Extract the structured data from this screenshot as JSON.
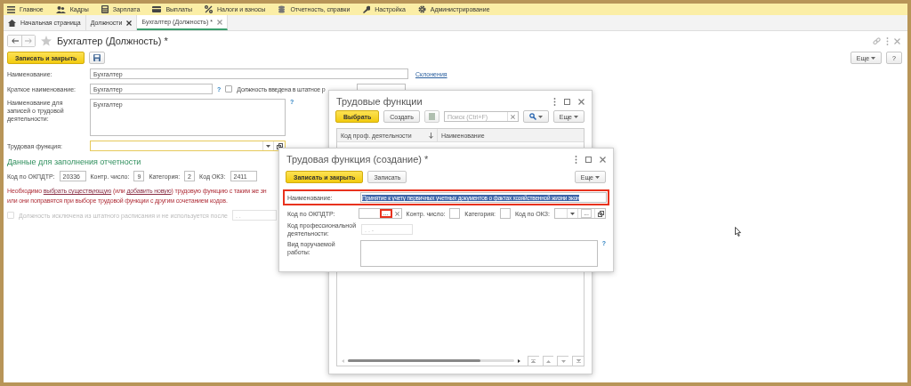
{
  "menu": [
    {
      "label": "Главное"
    },
    {
      "label": "Кадры"
    },
    {
      "label": "Зарплата"
    },
    {
      "label": "Выплаты"
    },
    {
      "label": "Налоги и взносы"
    },
    {
      "label": "Отчетность, справки"
    },
    {
      "label": "Настройка"
    },
    {
      "label": "Администрирование"
    }
  ],
  "tabs": [
    {
      "label": "Начальная страница",
      "selected": false,
      "closable": false
    },
    {
      "label": "Должности",
      "selected": false,
      "closable": true
    },
    {
      "label": "Бухгалтер (Должность) *",
      "selected": true,
      "closable": true
    }
  ],
  "form": {
    "title": "Бухгалтер (Должность) *",
    "save_close": "Записать и закрыть",
    "more": "Еще",
    "help": "?",
    "name": {
      "label": "Наименование:",
      "value": "Бухгалтер",
      "link": "Склонения"
    },
    "short": {
      "label": "Краткое наименование:",
      "value": "Бухгалтер",
      "help": "?",
      "checkbox": "Должность введена в штатное р",
      "checked": false
    },
    "records": {
      "label": "Наименование для записей о трудовой деятельности:",
      "value": "Бухгалтер",
      "help": "?"
    },
    "labor": {
      "label": "Трудовая функция:"
    },
    "section": "Данные для заполнения отчетности",
    "codes": [
      {
        "label": "Код по ОКПДТР:",
        "value": "20336"
      },
      {
        "label": "Контр. число:",
        "value": "9"
      },
      {
        "label": "Категория:",
        "value": "2"
      },
      {
        "label": "Код ОКЗ:",
        "value": "2411"
      }
    ],
    "warning": {
      "parts": [
        {
          "kind": "text",
          "text": "Необходимо "
        },
        {
          "kind": "link",
          "text": "выбрать существующую"
        },
        {
          "kind": "text",
          "text": " (или "
        },
        {
          "kind": "link",
          "text": "добавить новую"
        },
        {
          "kind": "text",
          "text": ") трудовую функцию с таким же зн"
        }
      ],
      "line2": "или они поправятся при выборе трудовой функции с другим сочетанием кодов."
    },
    "excluded": {
      "label": "Должность исключена из штатного расписания и не используется после",
      "checked": false,
      "disabled": true,
      "date": ". ."
    }
  },
  "list_dialog": {
    "title": "Трудовые функции",
    "choose": "Выбрать",
    "create": "Создать",
    "search": {
      "placeholder": "Поиск (Ctrl+F)"
    },
    "more": "Еще",
    "columns": [
      "Код проф. деятельности",
      "Наименование"
    ]
  },
  "create_dialog": {
    "title": "Трудовая функция (создание) *",
    "save_close": "Записать и закрыть",
    "save": "Записать",
    "more": "Еще",
    "name": {
      "label": "Наименование:",
      "value": "Принятие к учету первичных учетных документов о фактах хозяйственной жизни экон",
      "highlighted": true
    },
    "okpdtr": {
      "label": "Код по ОКПДТР:",
      "pick": "...",
      "highlighted": true
    },
    "control": {
      "label": "Контр. число:"
    },
    "category": {
      "label": "Категория:"
    },
    "okz": {
      "label": "Код по ОКЗ:",
      "pick": "..."
    },
    "prof": {
      "label": "Код профессиональной деятельности:",
      "placeholder": ". . -"
    },
    "work": {
      "label": "Вид поручаемой работы:",
      "help": "?"
    }
  }
}
